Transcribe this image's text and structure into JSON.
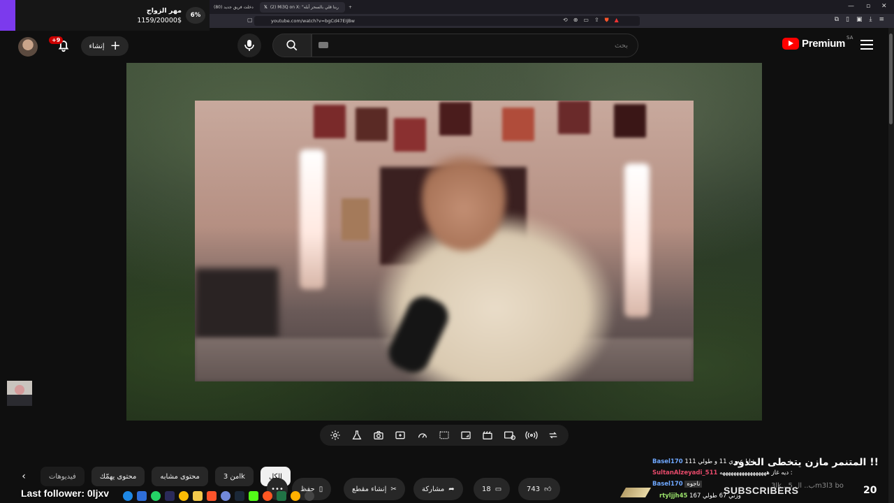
{
  "browser": {
    "tabs": [
      {
        "label": "(80) دخلت فريق جديد"
      },
      {
        "label": "(2) Mi3Q on X: \"ربنا قلي بالسحر أبله"
      }
    ],
    "url": "youtube.com/watch?v=bgCd47EIjBw"
  },
  "donation": {
    "title": "مهر الزواج",
    "amount": "1159/20000$",
    "percent": "6%",
    "percent_value": 0.06
  },
  "header": {
    "notif_badge": "+9",
    "create_label": "إنشاء",
    "search_placeholder": "بحث",
    "logo_text": "Premium",
    "country": "SA"
  },
  "chips": {
    "items": [
      {
        "label": "الكل",
        "active": true
      },
      {
        "label": "من 3lk",
        "active": false
      },
      {
        "label": "محتوى مشابه",
        "active": false
      },
      {
        "label": "محتوى يهمّك",
        "active": false
      },
      {
        "label": "فيديوهات",
        "active": false
      }
    ]
  },
  "actions": {
    "likes": "743",
    "comments": "18",
    "share": "مشاركة",
    "clip": "إنشاء مقطع",
    "save": "حفظ"
  },
  "chat": {
    "headline": "المتنمر مازن يتخطى الحدود !!",
    "lines": [
      {
        "user": "Basel170",
        "text": "انا عمري 11 و طولي 111 :"
      },
      {
        "user": "SultanAlzeyadi_511",
        "text": "ديه غاز هههههههههههههههههه :"
      },
      {
        "user": "Basel170",
        "text": "ناجوه"
      }
    ],
    "bottom_user": "rtyljjh45",
    "bottom_text": "وزني 67 طولي 167",
    "ghost_text": "3lk ..ب.. ال 5m3l3 bo"
  },
  "stream": {
    "last_follower": "Last follower: 0ljxv",
    "subscribers_label": "SUBSCRIBERS",
    "subscribers_count": "20"
  },
  "colors": {
    "accent_purple": "#7c3aed",
    "yt_red": "#ff0000",
    "badge_red": "#cc0000"
  }
}
